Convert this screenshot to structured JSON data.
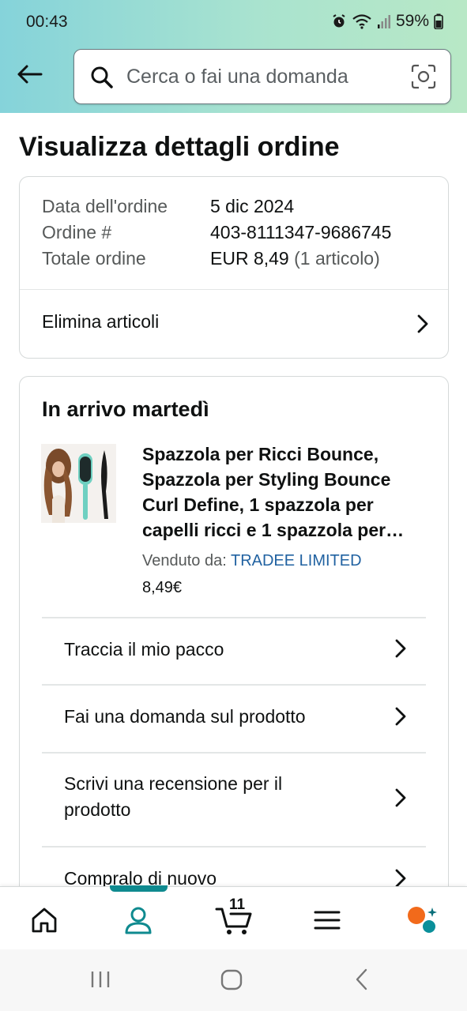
{
  "status": {
    "time": "00:43",
    "battery": "59%"
  },
  "search": {
    "placeholder": "Cerca o fai una domanda"
  },
  "page": {
    "title": "Visualizza dettagli ordine"
  },
  "order": {
    "date_label": "Data dell'ordine",
    "date_value": "5 dic 2024",
    "number_label": "Ordine #",
    "number_value": "403-8111347-9686745",
    "total_label": "Totale ordine",
    "total_value": "EUR 8,49",
    "total_items": "(1 articolo)",
    "delete_label": "Elimina articoli"
  },
  "shipment": {
    "heading": "In arrivo martedì",
    "product_title": "Spazzola per Ricci Bounce, Spazzola per Styling Bounce Curl Define, 1 spazzola per capelli ricci e 1 spazzola per…",
    "seller_prefix": "Venduto da:",
    "seller_name": "TRADEE LIMITED",
    "price": "8,49€",
    "actions": [
      {
        "label": "Traccia il mio pacco"
      },
      {
        "label": "Fai una domanda sul prodotto"
      },
      {
        "label": "Scrivi una recensione per il prodotto"
      },
      {
        "label": "Compralo di nuovo"
      }
    ]
  },
  "nav": {
    "cart_count": "11",
    "active": "account"
  },
  "colors": {
    "accent": "#0f8a8f",
    "link": "#2162a1",
    "header_start": "#85d3da",
    "header_end": "#b8e8c6"
  }
}
